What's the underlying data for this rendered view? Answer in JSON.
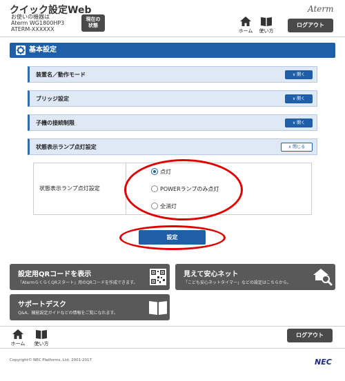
{
  "header": {
    "title": "クイック設定Web",
    "device_lines": [
      "お使いの機器は",
      "Aterm WG1800HP3",
      "ATERM-XXXXXX"
    ],
    "status_button": [
      "現在の",
      "状態"
    ],
    "brand": "Aterm",
    "home_label": "ホーム",
    "help_label": "使い方",
    "logout_label": "ログアウト"
  },
  "section": {
    "title": "基本設定"
  },
  "accordion": [
    {
      "label": "装置名／動作モード",
      "button": "開く"
    },
    {
      "label": "ブリッジ設定",
      "button": "開く"
    },
    {
      "label": "子機の接続制限",
      "button": "開く"
    },
    {
      "label": "状態表示ランプ点灯設定",
      "button": "閉じる"
    }
  ],
  "lamp_setting": {
    "label": "状態表示ランプ点灯設定",
    "options": [
      "点灯",
      "POWERランプのみ点灯",
      "全消灯"
    ],
    "selected_index": 0
  },
  "submit_label": "設定",
  "tiles": {
    "qr": {
      "title": "設定用QRコードを表示",
      "desc": "「AtermらくらくQRスタート」用のQRコードを作成できます。"
    },
    "safety": {
      "title": "見えて安心ネット",
      "desc": "「こども安心ネットタイマー」などの設定はこちらから。"
    },
    "support": {
      "title": "サポートデスク",
      "desc": "Q&A、機能設定ガイドなどの情報をご覧になれます。"
    }
  },
  "footer": {
    "home_label": "ホーム",
    "help_label": "使い方",
    "logout_label": "ログアウト",
    "copyright": "Copyright© NEC Platforms, Ltd. 2001-2017",
    "brand": "NEC"
  },
  "colors": {
    "accent": "#1f5fa8",
    "highlight": "#e00000",
    "tile": "#595959"
  }
}
